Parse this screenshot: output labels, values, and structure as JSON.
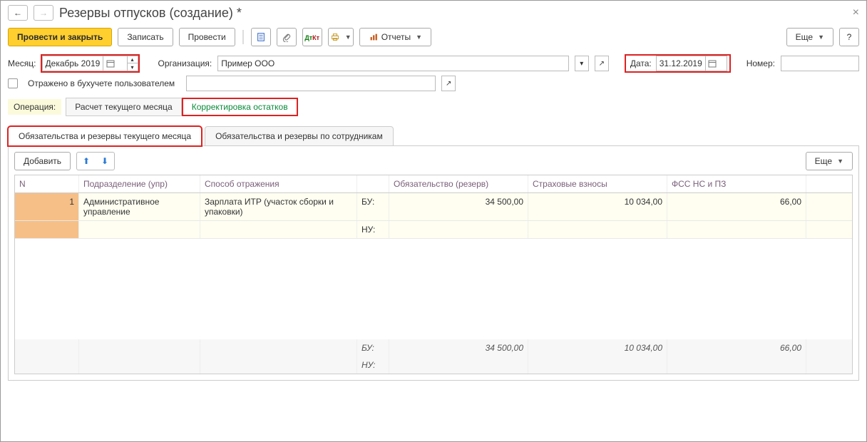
{
  "header": {
    "title": "Резервы отпусков (создание) *",
    "close": "×"
  },
  "toolbar": {
    "primary": "Провести и закрыть",
    "save": "Записать",
    "post": "Провести",
    "reports": "Отчеты",
    "more": "Еще"
  },
  "fields": {
    "month_label": "Месяц:",
    "month_value": "Декабрь 2019",
    "org_label": "Организация:",
    "org_value": "Пример ООО",
    "date_label": "Дата:",
    "date_value": "31.12.2019",
    "number_label": "Номер:",
    "number_value": "",
    "reflected_label": "Отражено в бухучете пользователем",
    "reflected_value": ""
  },
  "operation": {
    "label": "Операция:",
    "calc": "Расчет текущего месяца",
    "correct": "Корректировка остатков"
  },
  "tabs": {
    "tab1": "Обязательства и резервы текущего месяца",
    "tab2": "Обязательства и резервы по сотрудникам"
  },
  "grid_toolbar": {
    "add": "Добавить",
    "more": "Еще"
  },
  "grid": {
    "headers": {
      "n": "N",
      "dept": "Подразделение (упр)",
      "method": "Способ отражения",
      "blank": "",
      "liability": "Обязательство (резерв)",
      "insurance": "Страховые взносы",
      "fss": "ФСС НС и ПЗ"
    },
    "row1": {
      "n": "1",
      "dept": "Административное управление",
      "method": "Зарплата ИТР (участок сборки и упаковки)",
      "bu": "БУ:",
      "nu": "НУ:",
      "liability": "34 500,00",
      "insurance": "10 034,00",
      "fss": "66,00"
    },
    "footer": {
      "bu": "БУ:",
      "nu": "НУ:",
      "liability": "34 500,00",
      "insurance": "10 034,00",
      "fss": "66,00"
    }
  }
}
